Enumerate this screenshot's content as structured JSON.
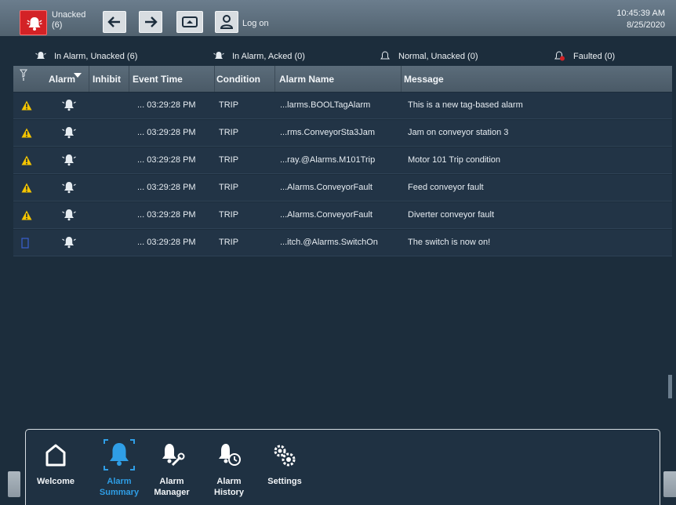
{
  "topbar": {
    "unacked_label": "Unacked",
    "unacked_count": "(6)",
    "logon_label": "Log on",
    "time": "10:45:39 AM",
    "date": "8/25/2020"
  },
  "filters": [
    {
      "label": "In Alarm, Unacked (6)",
      "icon": "bell-alarm-icon"
    },
    {
      "label": "In Alarm, Acked (0)",
      "icon": "bell-alarm-icon"
    },
    {
      "label": "Normal, Unacked (0)",
      "icon": "bell-outline-icon"
    },
    {
      "label": "Faulted (0)",
      "icon": "bell-fault-icon"
    }
  ],
  "columns": {
    "alarm": "Alarm",
    "inhibit": "Inhibit",
    "event_time": "Event Time",
    "condition": "Condition",
    "alarm_name": "Alarm Name",
    "message": "Message"
  },
  "rows": [
    {
      "severity": "warning",
      "event_time": "... 03:29:28 PM",
      "condition": "TRIP",
      "alarm_name": "...larms.BOOLTagAlarm",
      "message": "This is a new tag-based alarm"
    },
    {
      "severity": "warning",
      "event_time": "... 03:29:28 PM",
      "condition": "TRIP",
      "alarm_name": "...rms.ConveyorSta3Jam",
      "message": "Jam on conveyor station 3"
    },
    {
      "severity": "warning",
      "event_time": "... 03:29:28 PM",
      "condition": "TRIP",
      "alarm_name": "...ray.@Alarms.M101Trip",
      "message": "Motor 101 Trip condition"
    },
    {
      "severity": "warning",
      "event_time": "... 03:29:28 PM",
      "condition": "TRIP",
      "alarm_name": "...Alarms.ConveyorFault",
      "message": "Feed conveyor fault"
    },
    {
      "severity": "warning",
      "event_time": "... 03:29:28 PM",
      "condition": "TRIP",
      "alarm_name": "...Alarms.ConveyorFault",
      "message": "Diverter conveyor fault"
    },
    {
      "severity": "info",
      "event_time": "... 03:29:28 PM",
      "condition": "TRIP",
      "alarm_name": "...itch.@Alarms.SwitchOn",
      "message": "The switch is now on!"
    }
  ],
  "nav": [
    {
      "label": "Welcome",
      "icon": "home-icon",
      "active": false
    },
    {
      "label": "Alarm Summary",
      "icon": "bell-icon",
      "active": true
    },
    {
      "label": "Alarm Manager",
      "icon": "bell-wrench-icon",
      "active": false
    },
    {
      "label": "Alarm History",
      "icon": "bell-history-icon",
      "active": false
    },
    {
      "label": "Settings",
      "icon": "gears-icon",
      "active": false
    }
  ],
  "colors": {
    "alarm_red": "#d32226",
    "warning_yellow": "#f4c400",
    "active_blue": "#2f9ee6",
    "background": "#1c2d3c"
  }
}
